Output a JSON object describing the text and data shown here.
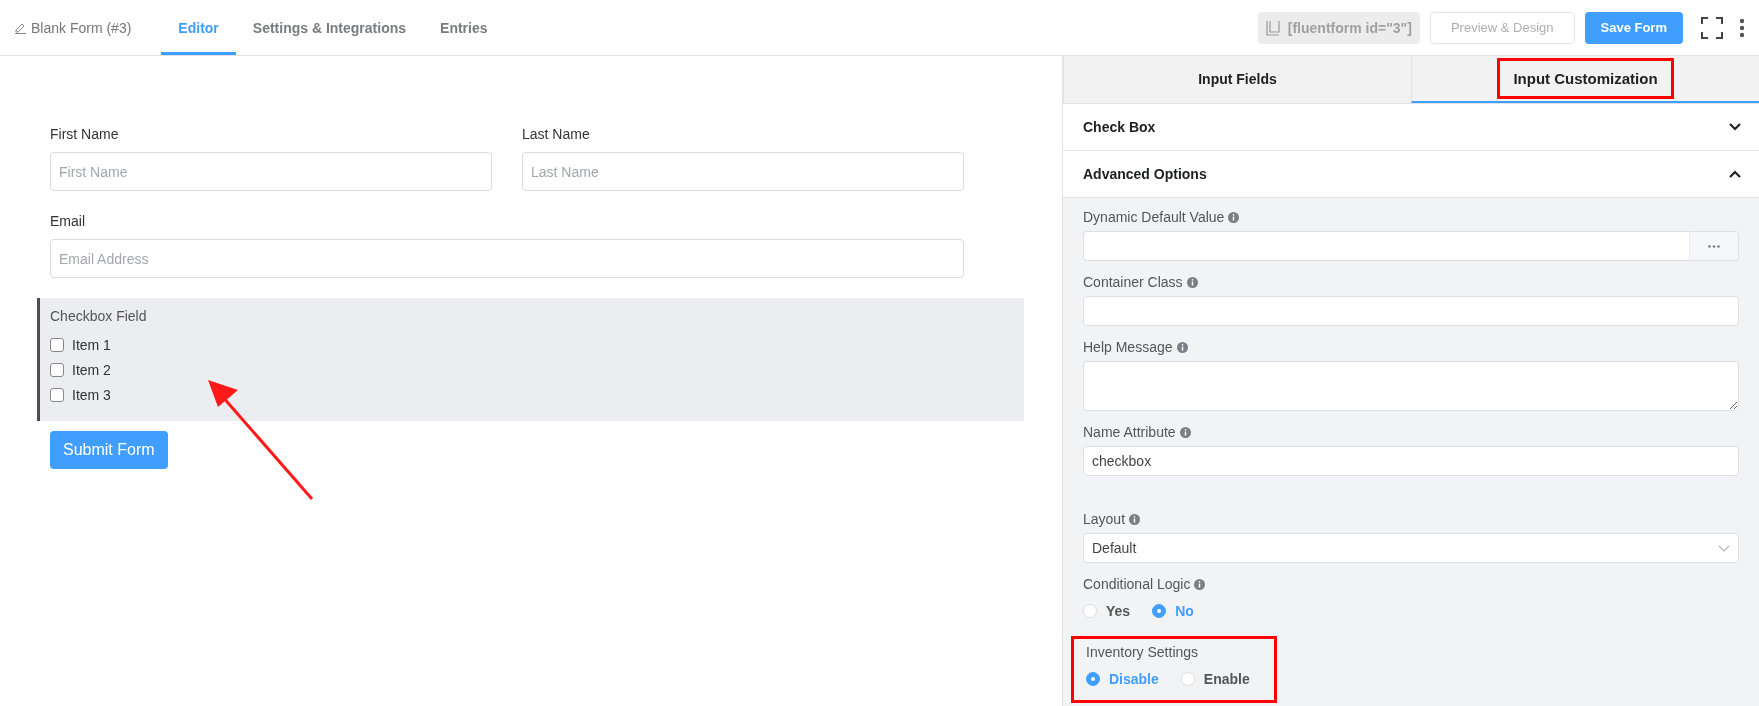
{
  "header": {
    "form_title": "Blank Form (#3)",
    "tabs": [
      {
        "label": "Editor",
        "selected": true
      },
      {
        "label": "Settings & Integrations",
        "selected": false
      },
      {
        "label": "Entries",
        "selected": false
      }
    ],
    "shortcode": "[fluentform id=\"3\"]",
    "preview_button": "Preview & Design",
    "save_button": "Save Form"
  },
  "form": {
    "rows": [
      [
        {
          "label": "First Name",
          "placeholder": "First Name"
        },
        {
          "label": "Last Name",
          "placeholder": "Last Name"
        }
      ],
      [
        {
          "label": "Email",
          "placeholder": "Email Address"
        }
      ]
    ],
    "checkbox_field": {
      "label": "Checkbox Field",
      "selected": true,
      "options": [
        {
          "label": "Item 1",
          "checked": false
        },
        {
          "label": "Item 2",
          "checked": false
        },
        {
          "label": "Item 3",
          "checked": false
        }
      ]
    },
    "submit_button": "Submit Form"
  },
  "sidebar": {
    "tabs": [
      {
        "label": "Input Fields",
        "selected": false,
        "highlighted": false
      },
      {
        "label": "Input Customization",
        "selected": true,
        "highlighted": true
      }
    ],
    "sections": [
      {
        "title": "Check Box",
        "expanded": false
      },
      {
        "title": "Advanced Options",
        "expanded": true
      }
    ],
    "fields": [
      {
        "kind": "text_button",
        "label": "Dynamic Default Value",
        "info": true
      },
      {
        "kind": "text",
        "label": "Container Class",
        "info": true
      },
      {
        "kind": "textarea",
        "label": "Help Message",
        "info": true
      },
      {
        "kind": "text",
        "label": "Name Attribute",
        "info": true,
        "value": "checkbox"
      },
      {
        "kind": "select",
        "label": "Layout",
        "info": true,
        "value": "Default"
      },
      {
        "kind": "radio",
        "label": "Conditional Logic",
        "info": true,
        "highlighted": false,
        "options": [
          {
            "label": "Yes",
            "selected": false
          },
          {
            "label": "No",
            "selected": true
          }
        ]
      },
      {
        "kind": "radio",
        "label": "Inventory Settings",
        "info": false,
        "highlighted": true,
        "options": [
          {
            "label": "Disable",
            "selected": true
          },
          {
            "label": "Enable",
            "selected": false
          }
        ]
      }
    ]
  }
}
